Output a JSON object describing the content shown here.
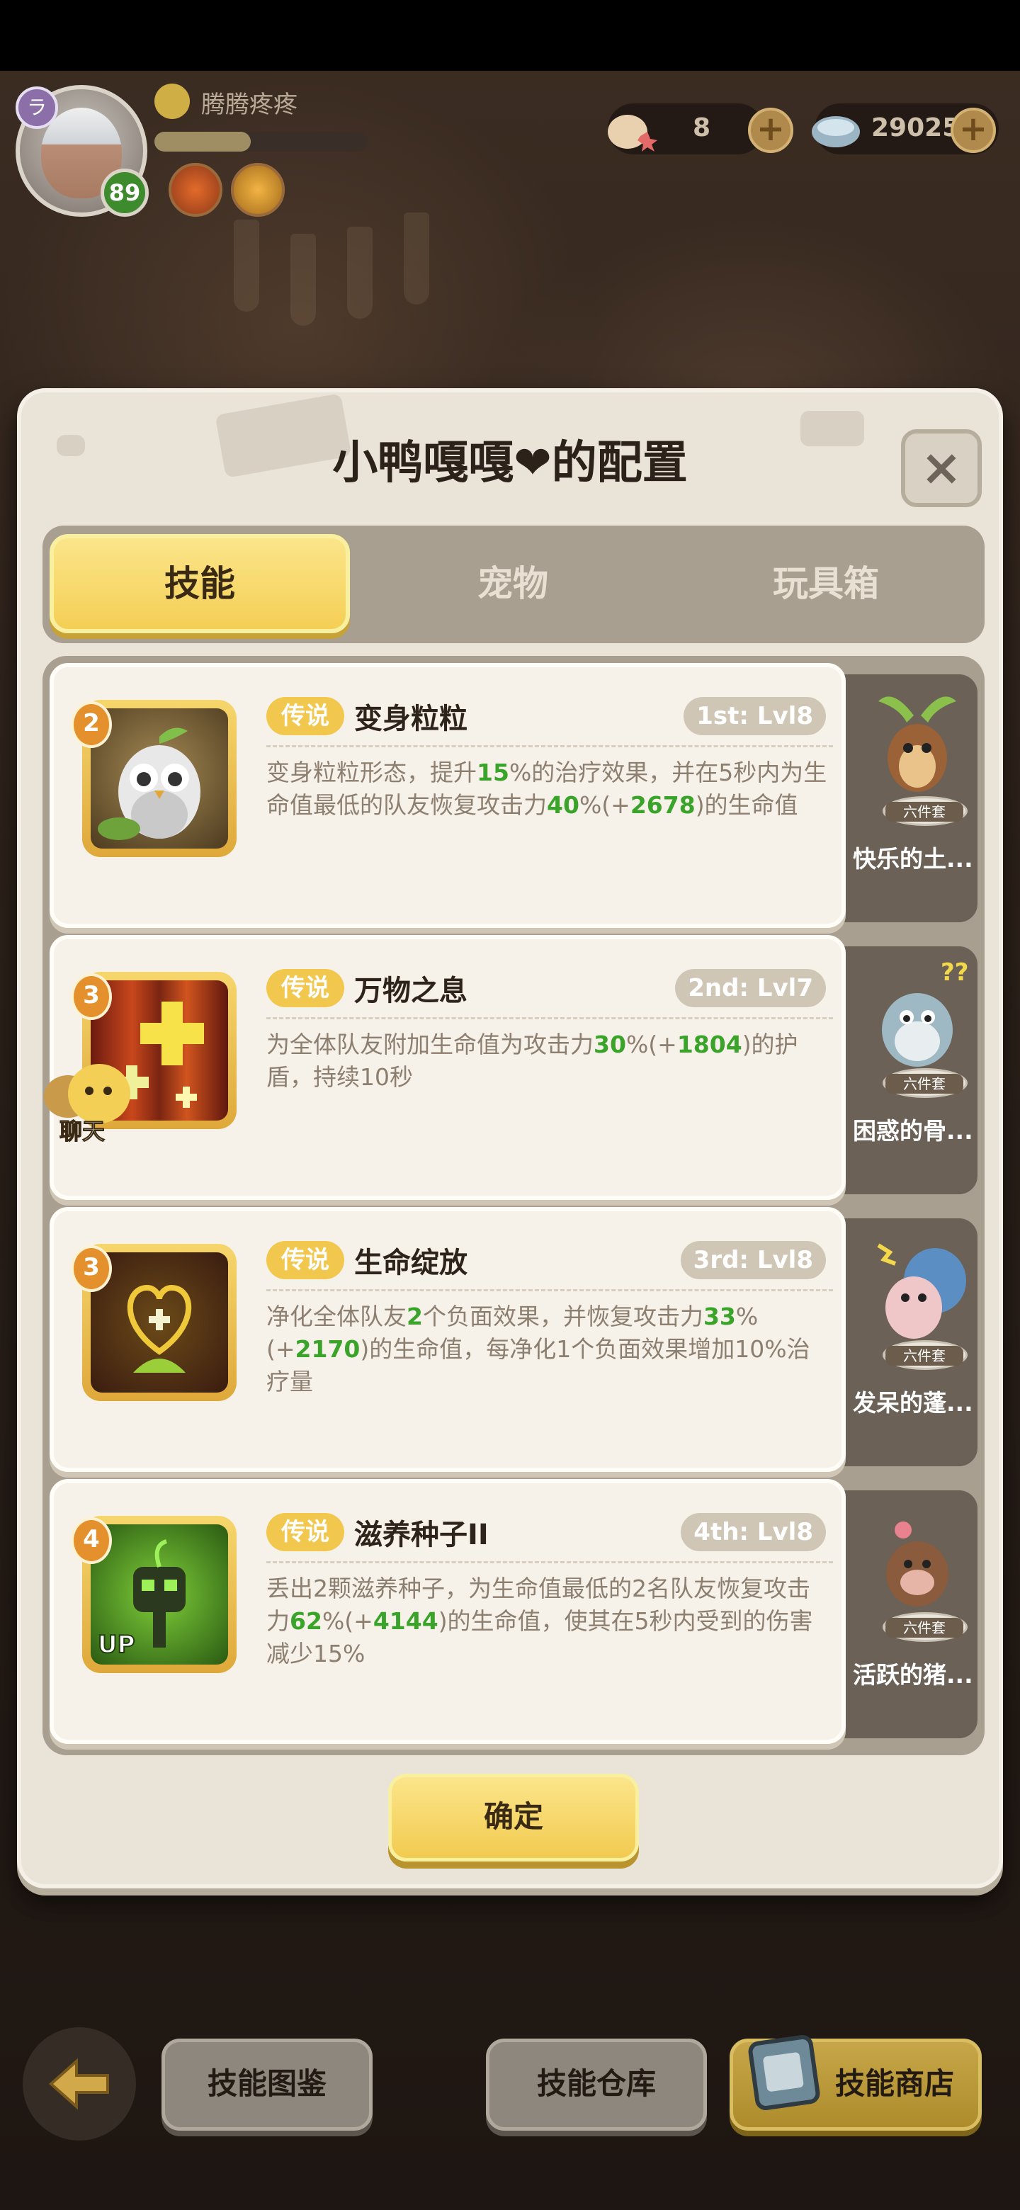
{
  "player": {
    "name": "腾腾疼疼",
    "level": "89",
    "avatar_badge": "ラ",
    "xp_fraction": 0.45
  },
  "resources": {
    "shells": "8",
    "pearls": "29025",
    "plus_label": "+"
  },
  "dialog": {
    "title": "小鸭嘎嘎❤的配置",
    "close_label": "×",
    "tabs": [
      {
        "label": "技能",
        "active": true
      },
      {
        "label": "宠物",
        "active": false
      },
      {
        "label": "玩具箱",
        "active": false
      }
    ],
    "skills": [
      {
        "rank": "2",
        "rarity": "传说",
        "name": "变身粒粒",
        "level_tag": "1st: Lvl8",
        "desc_parts": [
          "变身粒粒形态，提升",
          "15",
          "%的治疗效果，并在5秒内为生命值最低的队友恢复攻击力",
          "40",
          "%(+",
          "2678",
          ")的生命值"
        ],
        "pet_name": "快乐的土...",
        "pet_set": "六件套"
      },
      {
        "rank": "3",
        "rarity": "传说",
        "name": "万物之息",
        "level_tag": "2nd: Lvl7",
        "desc_parts": [
          "为全体队友附加生命值为攻击力",
          "30",
          "%(+",
          "1804",
          ")的护盾，持续10秒"
        ],
        "pet_name": "困惑的骨...",
        "pet_set": "六件套"
      },
      {
        "rank": "3",
        "rarity": "传说",
        "name": "生命绽放",
        "level_tag": "3rd: Lvl8",
        "desc_parts": [
          "净化全体队友",
          "2",
          "个负面效果，并恢复攻击力",
          "33",
          "%(+",
          "2170",
          ")的生命值，每净化1个负面效果增加10%治疗量"
        ],
        "pet_name": "发呆的蓬...",
        "pet_set": "六件套"
      },
      {
        "rank": "4",
        "rarity": "传说",
        "name": "滋养种子II",
        "level_tag": "4th: Lvl8",
        "desc_parts": [
          "丢出2颗滋养种子，为生命值最低的2名队友恢复攻击力",
          "62",
          "%(+",
          "4144",
          ")的生命值，使其在5秒内受到的伤害减少15%"
        ],
        "pet_name": "活跃的猪...",
        "pet_set": "六件套",
        "icon_badge": "UP"
      }
    ],
    "confirm_label": "确定"
  },
  "chat_label": "聊天",
  "bottom": {
    "guide_label": "技能图鉴",
    "storage_label": "技能仓库",
    "shop_label": "技能商店"
  },
  "colors": {
    "highlight_green": "#3aa32a",
    "tab_active": "#f4cf55",
    "legend_tag": "#f2c74d",
    "rank_badge": "#e3902d"
  },
  "icons": [
    "owl-skill-icon",
    "cross-heal-skill-icon",
    "heart-flower-skill-icon",
    "seed-robot-skill-icon",
    "chat-bubble-icon",
    "back-arrow-icon",
    "shop-box-icon"
  ]
}
